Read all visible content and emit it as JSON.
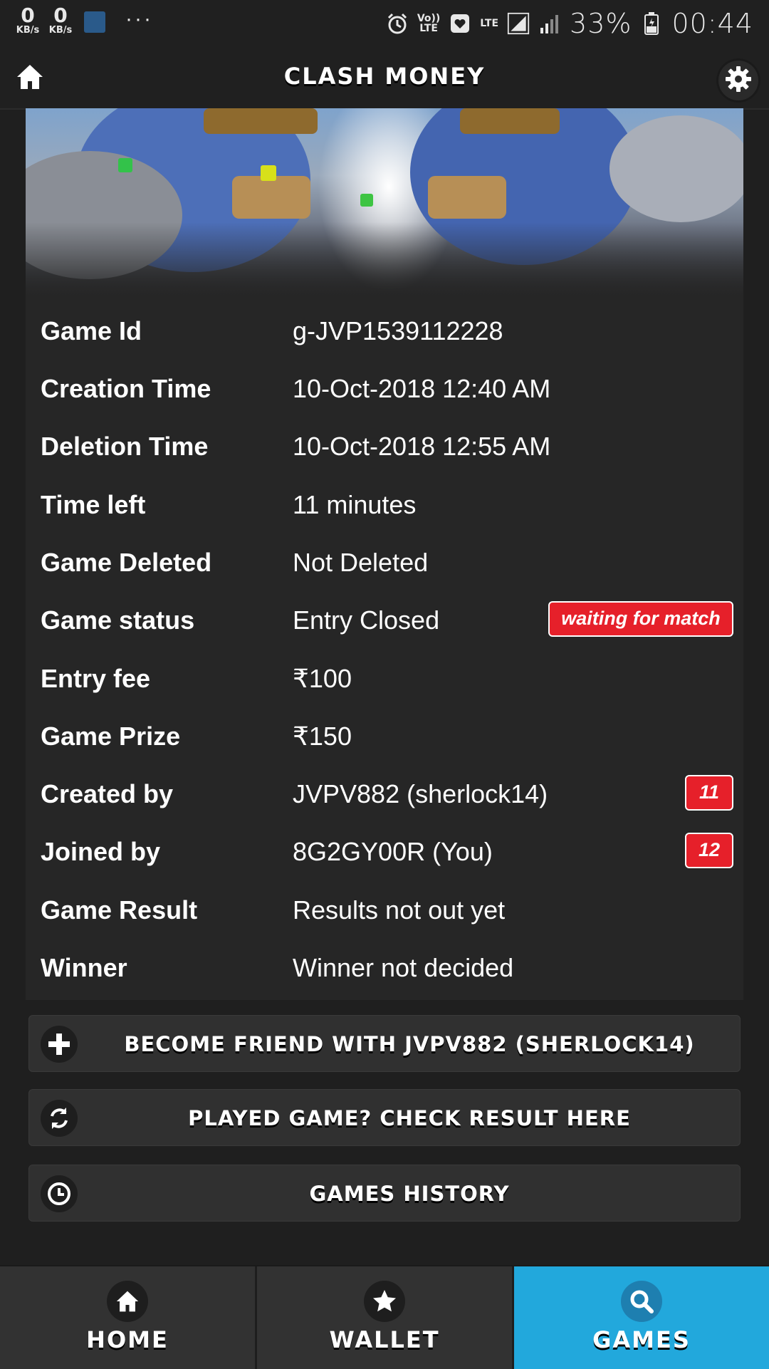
{
  "status_bar": {
    "net_down": "0",
    "net_down_unit": "KB/s",
    "net_up": "0",
    "net_up_unit": "KB/s",
    "more": "···",
    "volte": "Vo))\nLTE",
    "lte": "LTE",
    "battery": "33%",
    "time": "00:44"
  },
  "appbar": {
    "title": "CLASH MONEY"
  },
  "details": [
    {
      "label": "Game Id",
      "value": "g-JVP1539112228"
    },
    {
      "label": "Creation Time",
      "value": "10-Oct-2018 12:40 AM"
    },
    {
      "label": "Deletion Time",
      "value": "10-Oct-2018 12:55 AM"
    },
    {
      "label": "Time left",
      "value": "11 minutes"
    },
    {
      "label": "Game Deleted",
      "value": "Not Deleted"
    },
    {
      "label": "Game status",
      "value": "Entry Closed",
      "badge": "waiting for match"
    },
    {
      "label": "Entry fee",
      "value": "₹100"
    },
    {
      "label": "Game Prize",
      "value": "₹150"
    },
    {
      "label": "Created by",
      "value": "JVPV882 (sherlock14)",
      "badge": "11"
    },
    {
      "label": "Joined by",
      "value": "8G2GY00R (You)",
      "badge": "12"
    },
    {
      "label": "Game Result",
      "value": "Results not out yet"
    },
    {
      "label": "Winner",
      "value": "Winner not decided"
    }
  ],
  "actions": {
    "friend": "BECOME FRIEND WITH JVPV882 (SHERLOCK14)",
    "check_result": "PLAYED GAME? CHECK RESULT HERE",
    "history": "GAMES HISTORY"
  },
  "bottom_nav": {
    "home": "HOME",
    "wallet": "WALLET",
    "games": "GAMES",
    "active": "games"
  },
  "colors": {
    "accent": "#22a8dc",
    "badge_red": "#e6202a",
    "background": "#1f1f1f"
  },
  "icons": [
    "home-icon",
    "settings-icon",
    "plus-icon",
    "refresh-icon",
    "clock-icon",
    "star-icon",
    "search-icon"
  ]
}
